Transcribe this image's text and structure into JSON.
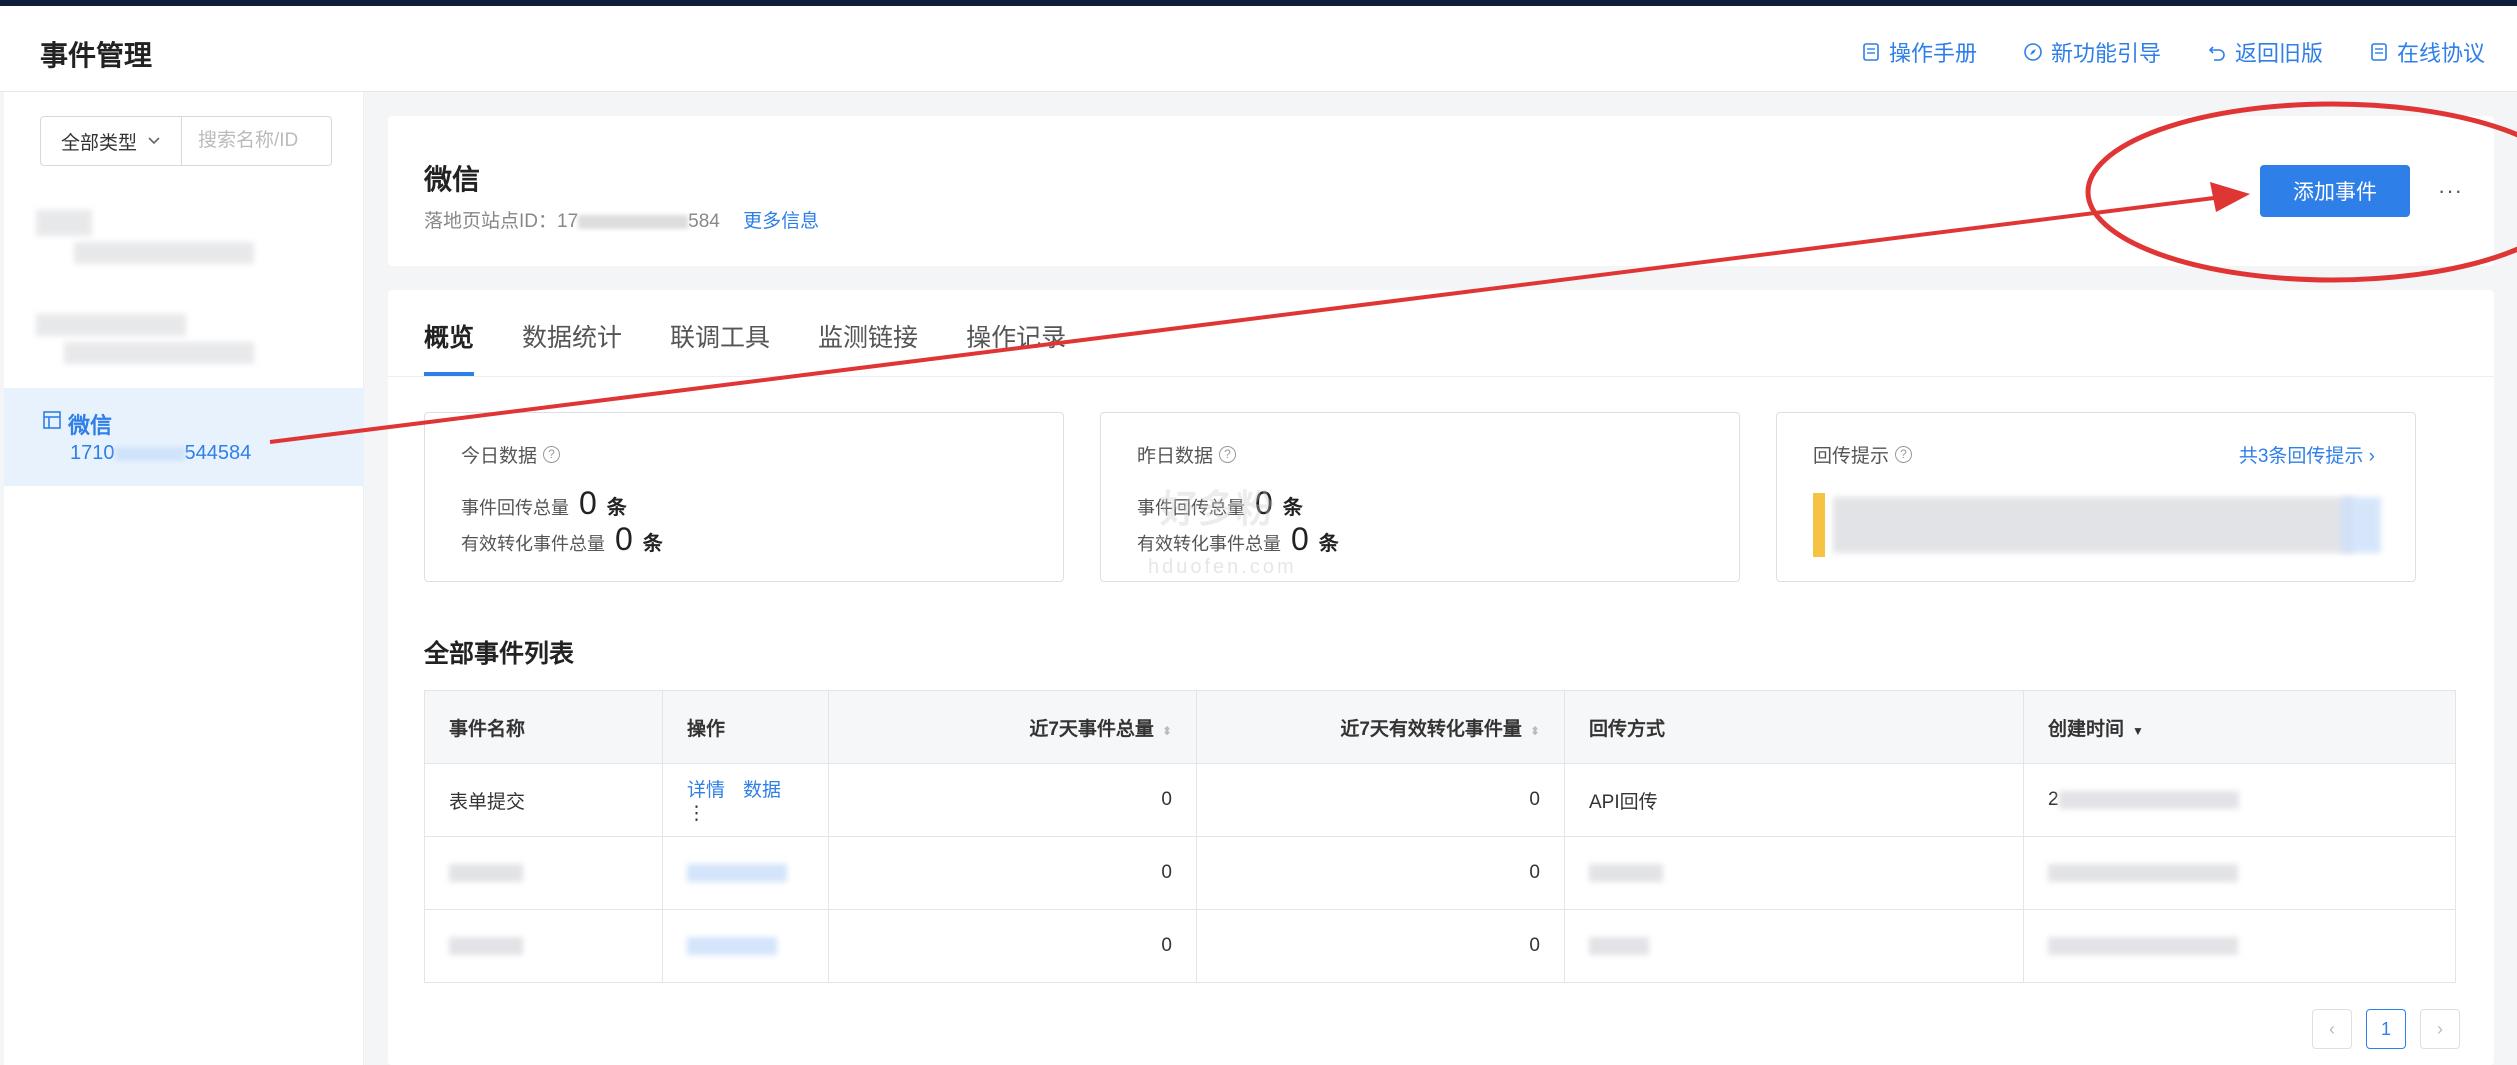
{
  "header": {
    "title": "事件管理",
    "links": [
      {
        "label": "操作手册",
        "icon": "document-icon"
      },
      {
        "label": "新功能引导",
        "icon": "compass-icon"
      },
      {
        "label": "返回旧版",
        "icon": "undo-icon"
      },
      {
        "label": "在线协议",
        "icon": "document-icon"
      }
    ]
  },
  "sidebar": {
    "filter_select": "全部类型",
    "search_placeholder": "搜索名称/ID",
    "active_item": {
      "name": "微信",
      "id_prefix": "1710",
      "id_suffix": "544584"
    }
  },
  "site": {
    "name": "微信",
    "id_label": "落地页站点ID：",
    "id_prefix": "17",
    "id_suffix": "584",
    "more_info": "更多信息",
    "add_button": "添加事件",
    "more_menu": "···"
  },
  "tabs": [
    "概览",
    "数据统计",
    "联调工具",
    "监测链接",
    "操作记录"
  ],
  "stats": {
    "today": {
      "title": "今日数据",
      "total_label": "事件回传总量",
      "total_value": "0",
      "valid_label": "有效转化事件总量",
      "valid_value": "0",
      "unit": "条"
    },
    "yesterday": {
      "title": "昨日数据",
      "total_label": "事件回传总量",
      "total_value": "0",
      "valid_label": "有效转化事件总量",
      "valid_value": "0",
      "unit": "条"
    },
    "tips": {
      "title": "回传提示",
      "link": "共3条回传提示 ›"
    }
  },
  "event_list": {
    "title": "全部事件列表",
    "columns": [
      "事件名称",
      "操作",
      "近7天事件总量",
      "近7天有效转化事件量",
      "回传方式",
      "创建时间"
    ],
    "rows": [
      {
        "name": "表单提交",
        "ops": [
          "详情",
          "数据"
        ],
        "more": "⋮",
        "total7": "0",
        "valid7": "0",
        "method": "API回传",
        "created": "2"
      },
      {
        "name": "",
        "ops": [],
        "total7": "0",
        "valid7": "0",
        "method": "",
        "created": ""
      },
      {
        "name": "",
        "ops": [],
        "total7": "0",
        "valid7": "0",
        "method": "",
        "created": ""
      }
    ]
  },
  "pagination": {
    "prev": "‹",
    "current": "1",
    "next": "›"
  },
  "watermark": {
    "line1": "好多粉",
    "line2": "hduofen.com"
  },
  "colors": {
    "accent": "#2f7fe8",
    "annotation": "#e03535",
    "tips_yellow": "#f6c244"
  }
}
